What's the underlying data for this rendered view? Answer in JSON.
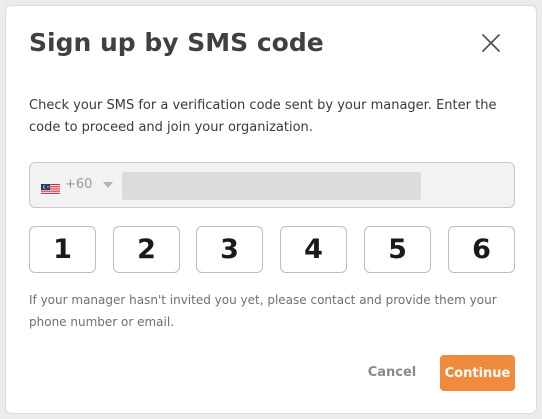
{
  "dialog": {
    "title": "Sign up by SMS code",
    "description": "Check your SMS for a verification code sent by your manager. Enter the code to proceed and join your organization.",
    "close_icon": "close-icon"
  },
  "phone": {
    "flag_icon": "malaysia-flag-icon",
    "country_code": "+60",
    "dropdown_icon": "caret-down-icon",
    "number_value": ""
  },
  "code": {
    "digits": [
      "1",
      "2",
      "3",
      "4",
      "5",
      "6"
    ]
  },
  "hint": "If your manager hasn't invited you yet, please contact and provide them your phone number or email.",
  "actions": {
    "cancel_label": "Cancel",
    "continue_label": "Continue"
  },
  "colors": {
    "accent": "#f08a3c",
    "title": "#404040",
    "muted": "#707070"
  }
}
